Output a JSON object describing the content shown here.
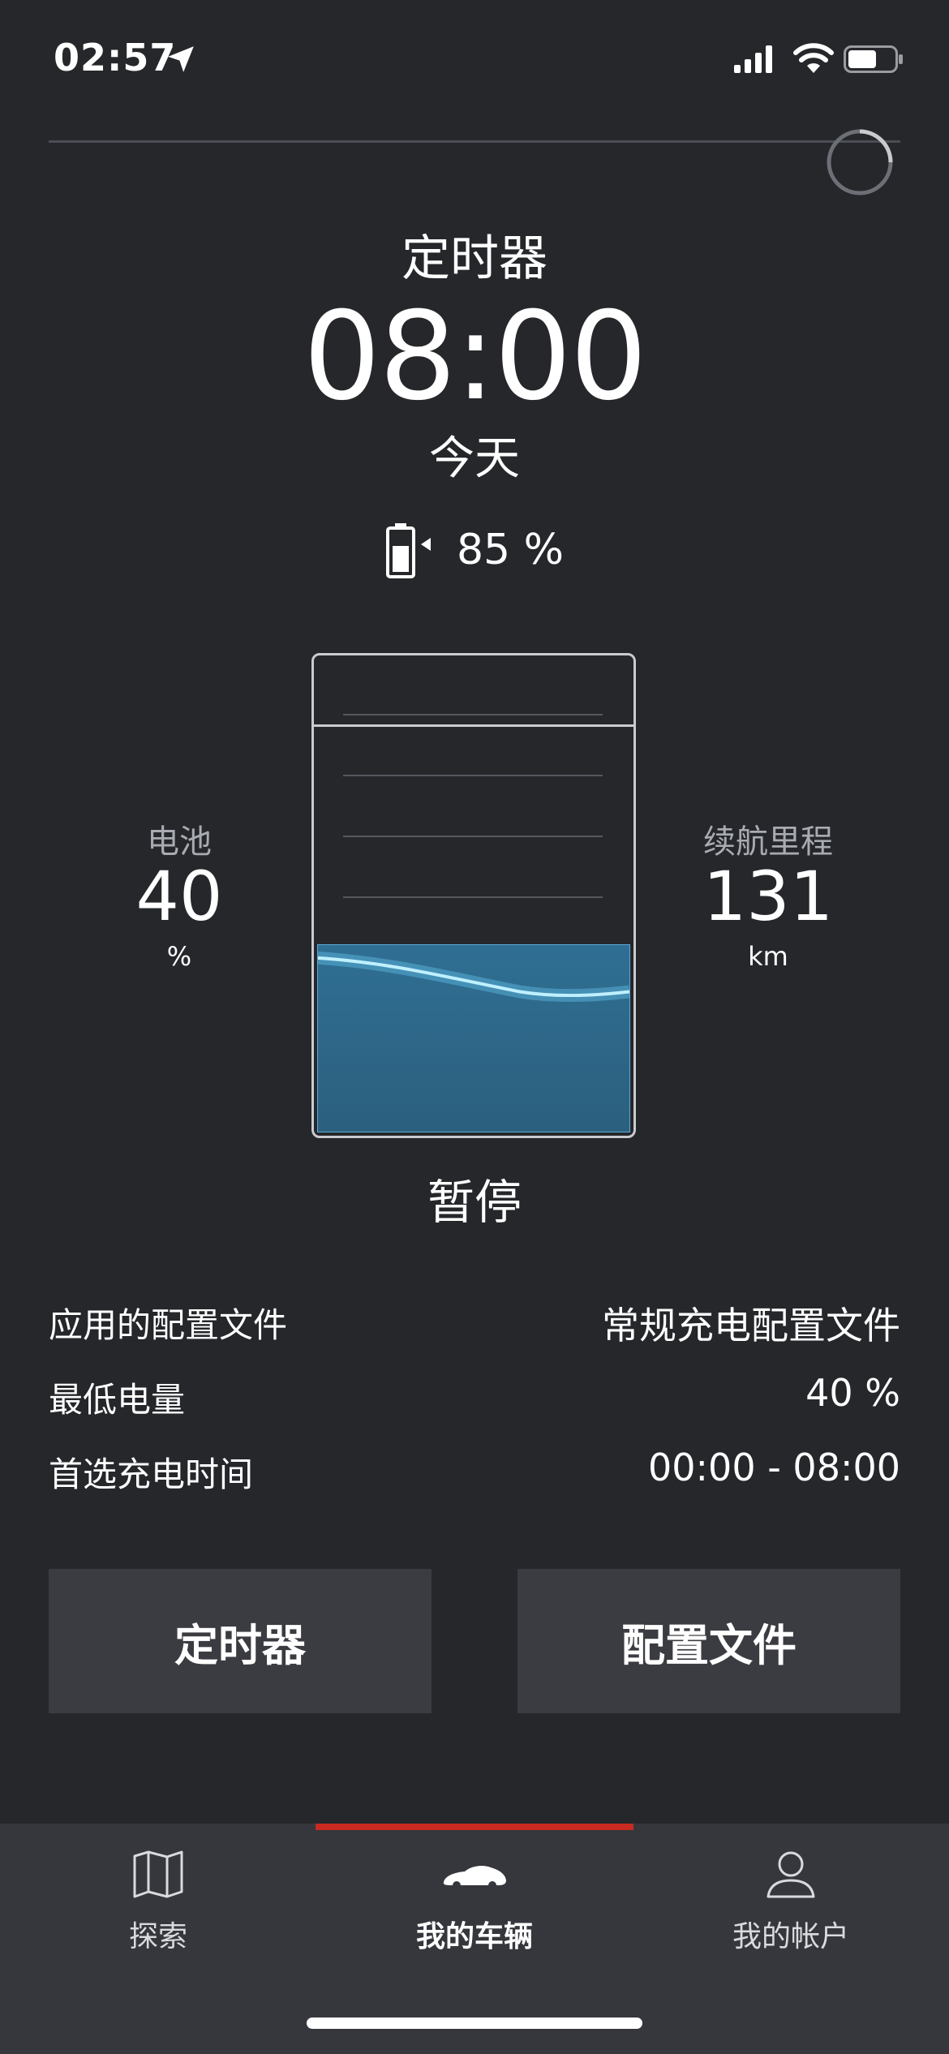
{
  "status_bar": {
    "time": "02:57"
  },
  "timer": {
    "title": "定时器",
    "time": "08:00",
    "day": "今天",
    "target_charge": "85 %"
  },
  "battery": {
    "level_percent": 40,
    "left": {
      "label": "电池",
      "value": "40",
      "unit": "%"
    },
    "right": {
      "label": "续航里程",
      "value": "131",
      "unit": "km"
    },
    "status": "暂停"
  },
  "info_rows": [
    {
      "label": "应用的配置文件",
      "value": "常规充电配置文件"
    },
    {
      "label": "最低电量",
      "value": "40 %"
    },
    {
      "label": "首选充电时间",
      "value": "00:00 - 08:00"
    }
  ],
  "buttons": {
    "timer": "定时器",
    "profile": "配置文件"
  },
  "tabs": [
    {
      "label": "探索",
      "icon": "map-icon",
      "active": false
    },
    {
      "label": "我的车辆",
      "icon": "car-icon",
      "active": true
    },
    {
      "label": "我的帐户",
      "icon": "user-icon",
      "active": false
    }
  ],
  "colors": {
    "background": "#25272b",
    "accent_red": "#c72b21",
    "battery_blue": "#3a92c4",
    "button_bg": "#3a3c41"
  }
}
